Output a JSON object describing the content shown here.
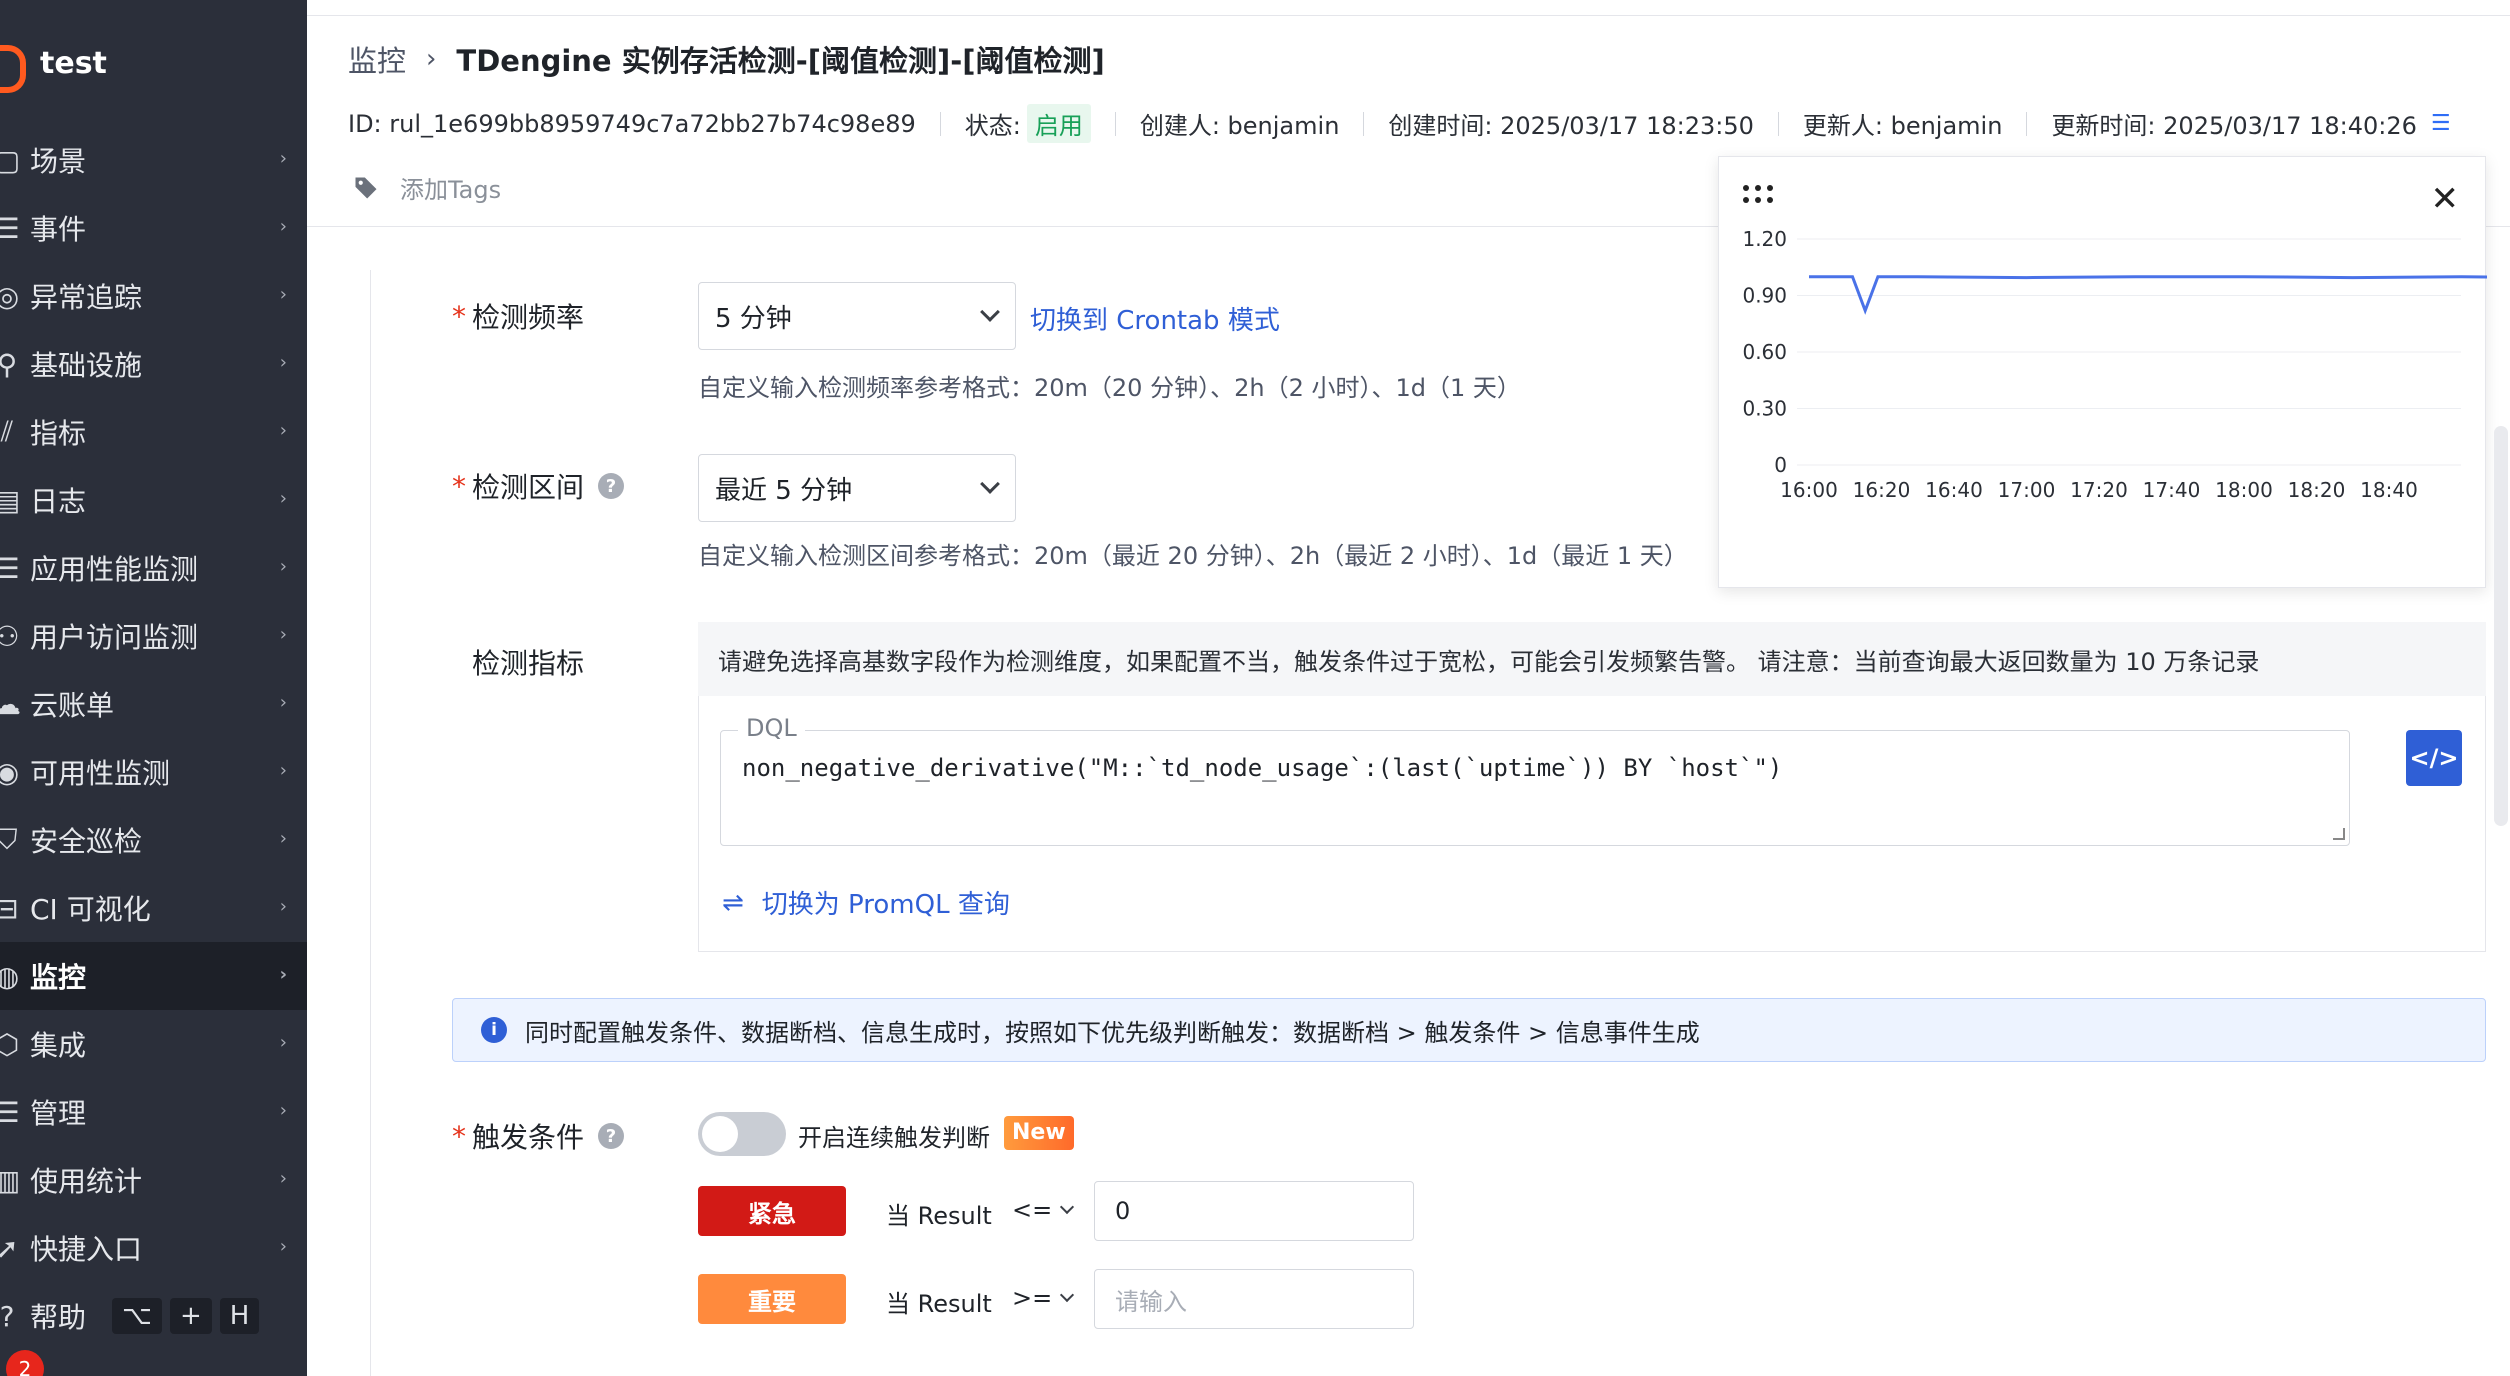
{
  "sidebar": {
    "brand": "test",
    "items": [
      {
        "label": "场景",
        "icon": "scene-icon",
        "icon_glyph": "▢"
      },
      {
        "label": "事件",
        "icon": "event-icon",
        "icon_glyph": "☰"
      },
      {
        "label": "异常追踪",
        "icon": "trace-icon",
        "icon_glyph": "◎"
      },
      {
        "label": "基础设施",
        "icon": "infrastructure-icon",
        "icon_glyph": "⚲"
      },
      {
        "label": "指标",
        "icon": "metrics-icon",
        "icon_glyph": "⫽"
      },
      {
        "label": "日志",
        "icon": "log-icon",
        "icon_glyph": "▤"
      },
      {
        "label": "应用性能监测",
        "icon": "apm-icon",
        "icon_glyph": "☰"
      },
      {
        "label": "用户访问监测",
        "icon": "rum-icon",
        "icon_glyph": "⚇"
      },
      {
        "label": "云账单",
        "icon": "cloud-bill-icon",
        "icon_glyph": "☁"
      },
      {
        "label": "可用性监测",
        "icon": "availability-icon",
        "icon_glyph": "◉"
      },
      {
        "label": "安全巡检",
        "icon": "security-icon",
        "icon_glyph": "⛉"
      },
      {
        "label": "CI 可视化",
        "icon": "ci-icon",
        "icon_glyph": "⊟"
      },
      {
        "label": "监控",
        "icon": "monitor-icon",
        "icon_glyph": "◍",
        "active": true
      },
      {
        "label": "集成",
        "icon": "integration-icon",
        "icon_glyph": "⬡"
      },
      {
        "label": "管理",
        "icon": "manage-icon",
        "icon_glyph": "☰"
      },
      {
        "label": "使用统计",
        "icon": "usage-icon",
        "icon_glyph": "▥"
      },
      {
        "label": "快捷入口",
        "icon": "shortcut-icon",
        "icon_glyph": "➚"
      }
    ],
    "help_label": "帮助",
    "help_keys": [
      "⌥",
      "+",
      "H"
    ],
    "notification_count": "2"
  },
  "header": {
    "breadcrumb_parent": "监控",
    "breadcrumb_sep": "›",
    "title": "TDengine 实例存活检测-[阈值检测]-[阈值检测]",
    "id": "ID: rul_1e699bb8959749c7a72bb27b74c98e89",
    "status_label": "状态:",
    "status_value": "启用",
    "creator": "创建人: benjamin",
    "created_at": "创建时间: 2025/03/17 18:23:50",
    "updater": "更新人: benjamin",
    "updated_at": "更新时间: 2025/03/17 18:40:26",
    "add_tags": "添加Tags"
  },
  "form": {
    "frequency": {
      "label": "检测频率",
      "value": "5 分钟",
      "crontab_link": "切换到 Crontab 模式",
      "hint": "自定义输入检测频率参考格式：20m（20 分钟）、2h（2 小时）、1d（1 天）"
    },
    "interval": {
      "label": "检测区间",
      "value": "最近 5 分钟",
      "hint": "自定义输入检测区间参考格式：20m（最近 20 分钟）、2h（最近 2 小时）、1d（最近 1 天）"
    },
    "metric": {
      "label": "检测指标",
      "warning": "请避免选择高基数字段作为检测维度，如果配置不当，触发条件过于宽松，可能会引发频繁告警。 请注意：当前查询最大返回数量为 10 万条记录",
      "dql_legend": "DQL",
      "dql_code": "non_negative_derivative(\"M::`td_node_usage`:(last(`uptime`)) BY `host`\")",
      "code_button": "</>",
      "promql_link": "切换为 PromQL 查询"
    },
    "info": "同时配置触发条件、数据断档、信息生成时，按照如下优先级判断触发：数据断档 > 触发条件 > 信息事件生成",
    "trigger": {
      "label": "触发条件",
      "toggle_label": "开启连续触发判断",
      "new_badge": "New",
      "rules": [
        {
          "level": "紧急",
          "color": "#d21a16",
          "condition": "当 Result",
          "operator": "<=",
          "value": "0",
          "placeholder": ""
        },
        {
          "level": "重要",
          "color": "#ff8a3d",
          "condition": "当 Result",
          "operator": ">=",
          "value": "",
          "placeholder": "请输入"
        }
      ]
    }
  },
  "chart_data": {
    "type": "line",
    "x": [
      "16:00",
      "16:20",
      "16:40",
      "17:00",
      "17:20",
      "17:40",
      "18:00",
      "18:20",
      "18:40"
    ],
    "y_ticks": [
      "1.20",
      "0.90",
      "0.60",
      "0.30",
      "0"
    ],
    "ylim": [
      0,
      1.2
    ],
    "series": [
      {
        "color": "#4a72e8",
        "points": [
          [
            0,
            1.0
          ],
          [
            5,
            1.0
          ],
          [
            12,
            1.0
          ],
          [
            15.5,
            0.82
          ],
          [
            19,
            1.0
          ],
          [
            30,
            1.0
          ],
          [
            60,
            0.995
          ],
          [
            90,
            1.0
          ],
          [
            120,
            1.0
          ],
          [
            150,
            0.995
          ],
          [
            180,
            1.0
          ],
          [
            200,
            0.995
          ]
        ]
      }
    ]
  }
}
